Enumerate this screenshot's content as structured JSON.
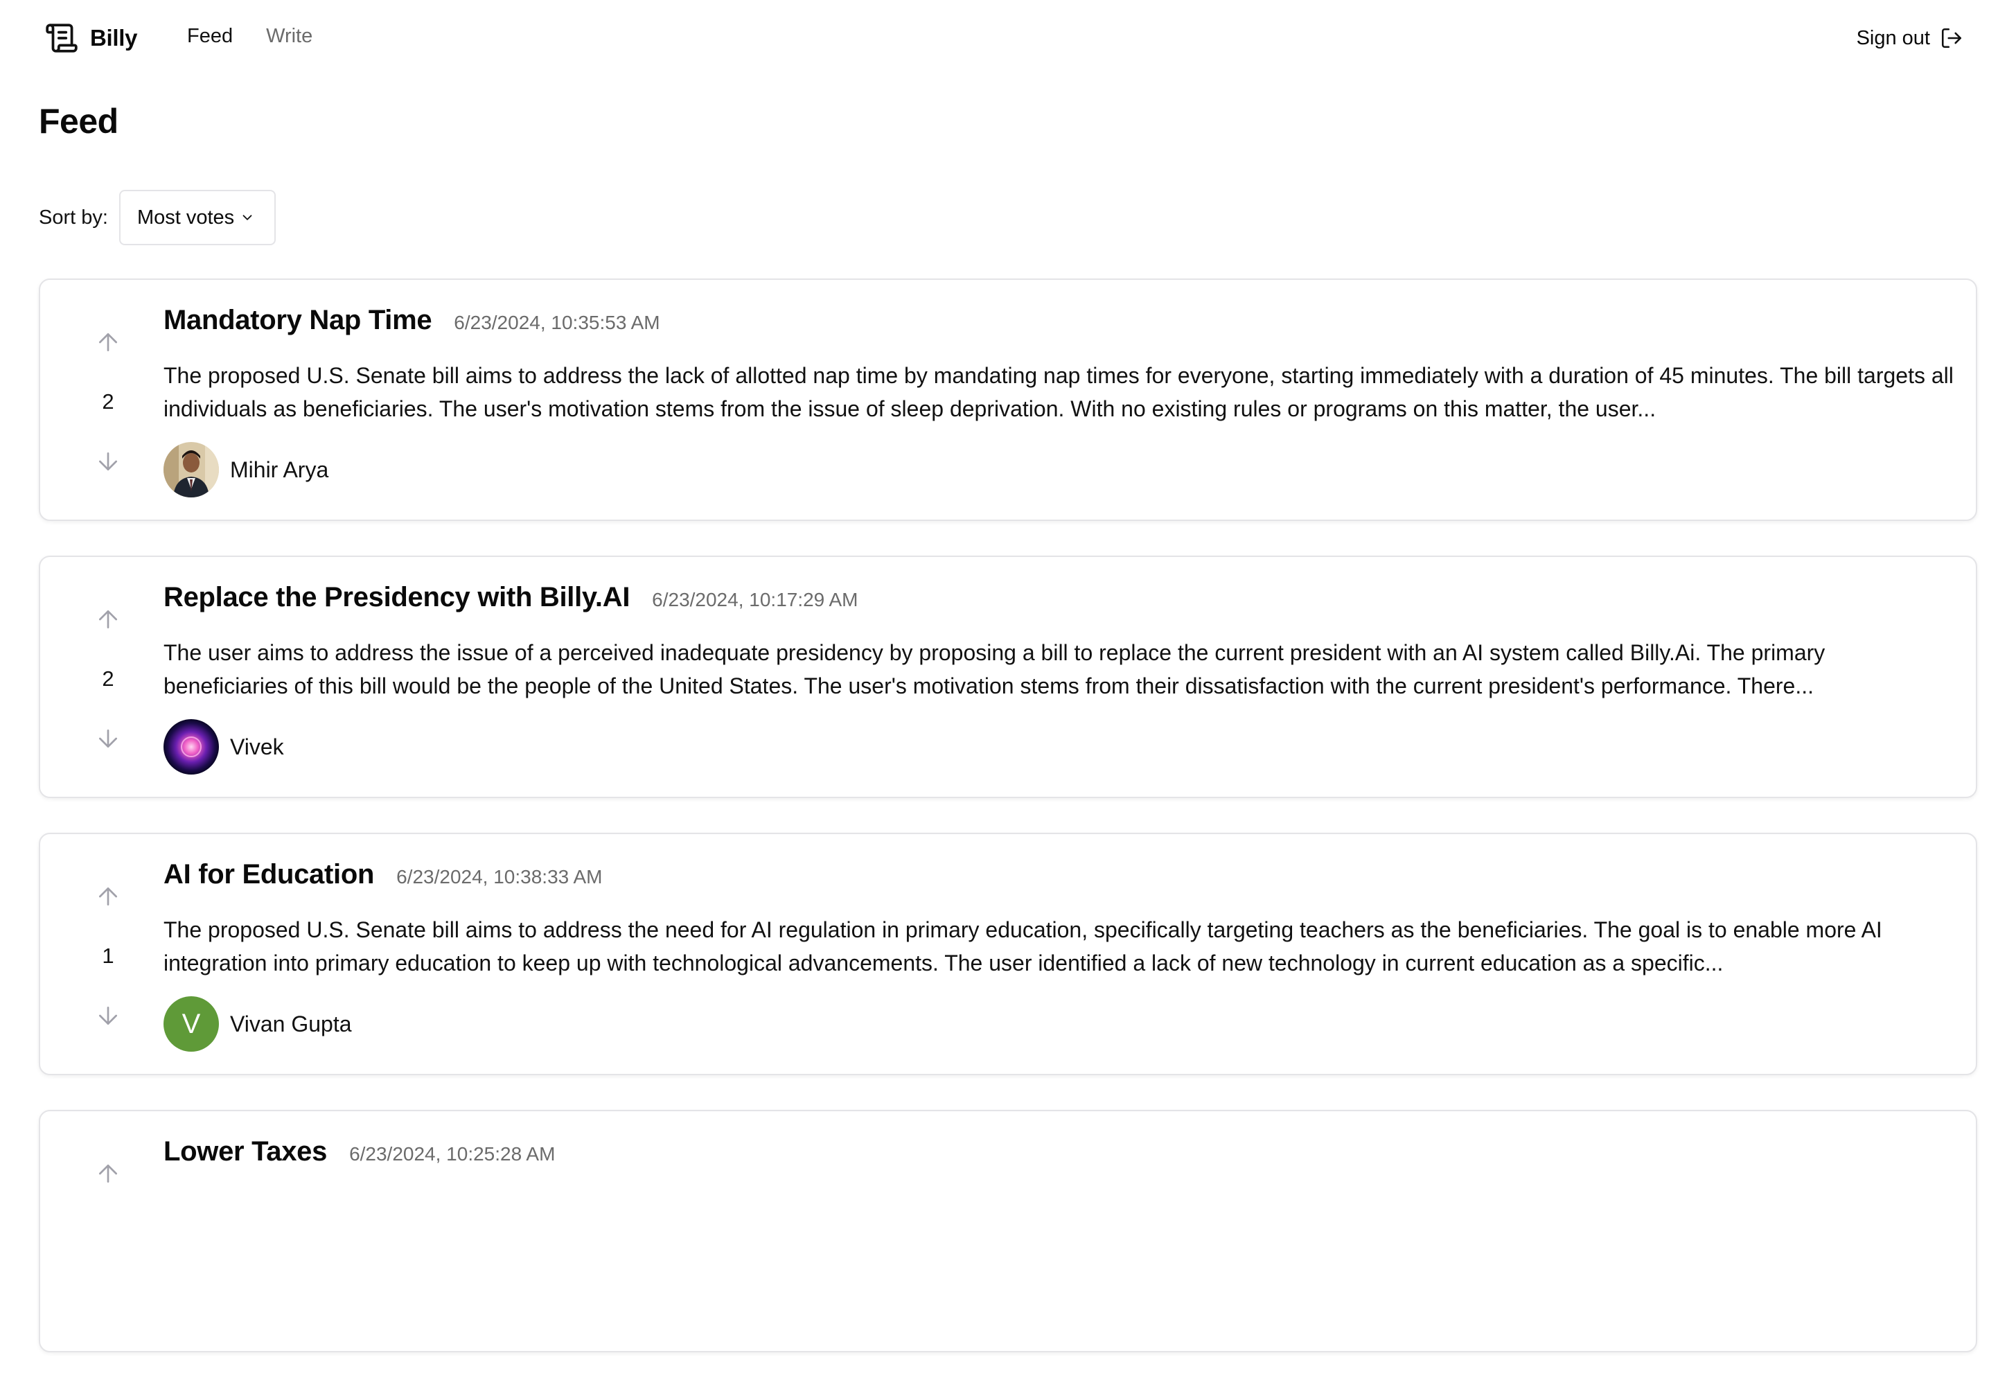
{
  "brand": {
    "name": "Billy",
    "icon": "scroll-icon"
  },
  "nav": {
    "items": [
      "Feed",
      "Write"
    ],
    "active": "Feed"
  },
  "header": {
    "signout_label": "Sign out",
    "signout_icon": "log-out-icon"
  },
  "page": {
    "title": "Feed"
  },
  "sort": {
    "label": "Sort by:",
    "value": "Most votes"
  },
  "posts": [
    {
      "title": "Mandatory Nap Time",
      "date": "6/23/2024, 10:35:53 AM",
      "votes": "2",
      "summary": "The proposed U.S. Senate bill aims to address the lack of allotted nap time by mandating nap times for everyone, starting immediately with a duration of 45 minutes. The bill targets all individuals as beneficiaries. The user's motivation stems from the issue of sleep deprivation. With no existing rules or programs on this matter, the user...",
      "author": "Mihir Arya",
      "avatar": "photo"
    },
    {
      "title": "Replace the Presidency with Billy.AI",
      "date": "6/23/2024, 10:17:29 AM",
      "votes": "2",
      "summary": "The user aims to address the issue of a perceived inadequate presidency by proposing a bill to replace the current president with an AI system called Billy.Ai. The primary beneficiaries of this bill would be the people of the United States. The user's motivation stems from their dissatisfaction with the current president's performance. There...",
      "author": "Vivek",
      "avatar": "orb"
    },
    {
      "title": "AI for Education",
      "date": "6/23/2024, 10:38:33 AM",
      "votes": "1",
      "summary": "The proposed U.S. Senate bill aims to address the need for AI regulation in primary education, specifically targeting teachers as the beneficiaries. The goal is to enable more AI integration into primary education to keep up with technological advancements. The user identified a lack of new technology in current education as a specific...",
      "author": "Vivan Gupta",
      "avatar": "letter",
      "avatar_letter": "V",
      "avatar_color": "#5f9a38"
    },
    {
      "title": "Lower Taxes",
      "date": "6/23/2024, 10:25:28 AM",
      "votes": "",
      "summary": "",
      "author": "",
      "avatar": "none"
    }
  ],
  "colors": {
    "muted_text": "#6b6b6b",
    "border": "#e4e4e7",
    "arrow": "#a1a1aa"
  }
}
